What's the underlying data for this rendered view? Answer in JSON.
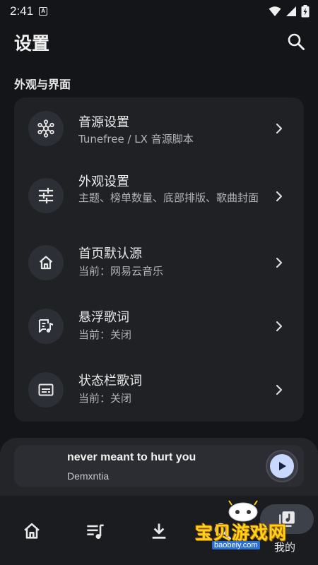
{
  "status_bar": {
    "time": "2:41",
    "notification_icon": "A",
    "icons": [
      "wifi-icon",
      "signal-icon",
      "battery-icon"
    ]
  },
  "header": {
    "title": "设置",
    "search_icon": "search-icon"
  },
  "section": {
    "title": "外观与界面"
  },
  "settings": [
    {
      "title": "音源设置",
      "subtitle": "Tunefree / LX 音源脚本",
      "icon": "hub-icon"
    },
    {
      "title": "外观设置",
      "subtitle": "主题、榜单数量、底部排版、歌曲封面",
      "icon": "tune-sliders-icon"
    },
    {
      "title": "首页默认源",
      "subtitle": "当前：网易云音乐",
      "icon": "home-icon"
    },
    {
      "title": "悬浮歌词",
      "subtitle": "当前：关闭",
      "icon": "lyrics-icon"
    },
    {
      "title": "状态栏歌词",
      "subtitle": "当前：关闭",
      "icon": "subtitles-icon"
    }
  ],
  "player": {
    "song_title": "never meant to hurt you",
    "artist": "Demxntia",
    "play_icon": "play-icon"
  },
  "bottom_nav": {
    "items": [
      {
        "icon": "home-icon"
      },
      {
        "icon": "playlist-icon"
      },
      {
        "icon": "download-icon"
      },
      {
        "icon": "search-icon"
      },
      {
        "icon": "music-library-icon",
        "label": "我的",
        "selected": true
      }
    ]
  },
  "watermark": {
    "text": "宝贝游戏网",
    "url": "baobeiy.com"
  },
  "colors": {
    "background": "#141518",
    "card": "#1f2125",
    "icon_circle": "#2c2f35",
    "accent": "#c9d8ff",
    "watermark": "#ffd21a"
  }
}
